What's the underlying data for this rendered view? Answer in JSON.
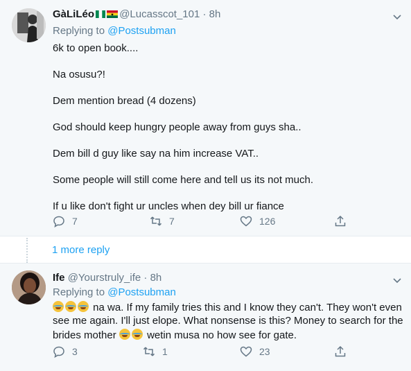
{
  "tweets": [
    {
      "name": "GàLiLéo",
      "handle": "@Lucasscot_101",
      "separator": "·",
      "time": "8h",
      "replying_label": "Replying to",
      "replying_to": "@Postsubman",
      "paragraphs": [
        "6k to open book....",
        "Na osusu?!",
        "Dem mention bread (4 dozens)",
        "God should keep hungry people away from guys sha..",
        "Dem bill d guy like say na him increase VAT..",
        "Some people will still come here and tell us its not much.",
        "If u like don't fight ur uncles when dey bill ur fiance"
      ],
      "replies": "7",
      "retweets": "7",
      "likes": "126",
      "flags": [
        "nigeria-flag-icon",
        "ghana-flag-icon"
      ]
    },
    {
      "name": "Ife",
      "handle": "@Yourstruly_ife",
      "separator": "·",
      "time": "8h",
      "replying_label": "Replying to",
      "replying_to": "@Postsubman",
      "line1": "na wa. If my family tries this and I know they can't. They won't even",
      "line2": "see me again.  I'll just elope. What nonsense is this? Money to search for the",
      "line3a": "brides mother",
      "line3b": "wetin musa no how see for gate.",
      "emoji_name": "face-with-tears-of-joy-icon",
      "replies": "3",
      "retweets": "1",
      "likes": "23"
    }
  ],
  "more_replies": "1 more reply",
  "colors": {
    "link": "#1da1f2",
    "muted": "#657786",
    "bg": "#f5f8fa"
  }
}
